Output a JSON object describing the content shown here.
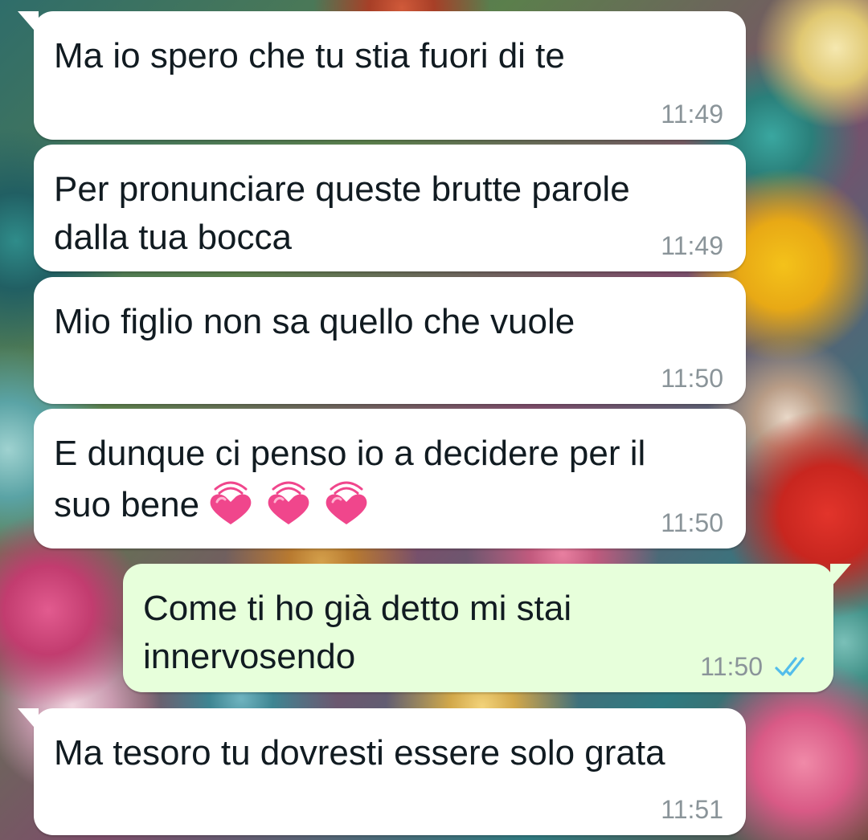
{
  "messages": [
    {
      "direction": "in",
      "text": "Ma io spero che tu stia fuori di te",
      "time": "11:49"
    },
    {
      "direction": "in",
      "text": "Per pronunciare queste brutte parole\ndalla tua bocca",
      "time": "11:49"
    },
    {
      "direction": "in",
      "text": "Mio figlio non sa quello che vuole",
      "time": "11:50"
    },
    {
      "direction": "in",
      "text": "E dunque ci penso io a decidere per il\nsuo bene",
      "time": "11:50",
      "emoji": [
        "growing-heart-icon",
        "growing-heart-icon",
        "growing-heart-icon"
      ]
    },
    {
      "direction": "out",
      "text": "Come ti ho già detto mi stai\ninnervosendo",
      "time": "11:50",
      "status_icon": "double-check-read-icon"
    },
    {
      "direction": "in",
      "text": "Ma tesoro tu dovresti essere solo grata",
      "time": "11:51"
    }
  ],
  "colors": {
    "incoming_bubble": "#ffffff",
    "outgoing_bubble": "#e7ffdb",
    "timestamp": "#8a9499",
    "read_ticks": "#53bdeb",
    "heart": "#f0468c"
  }
}
